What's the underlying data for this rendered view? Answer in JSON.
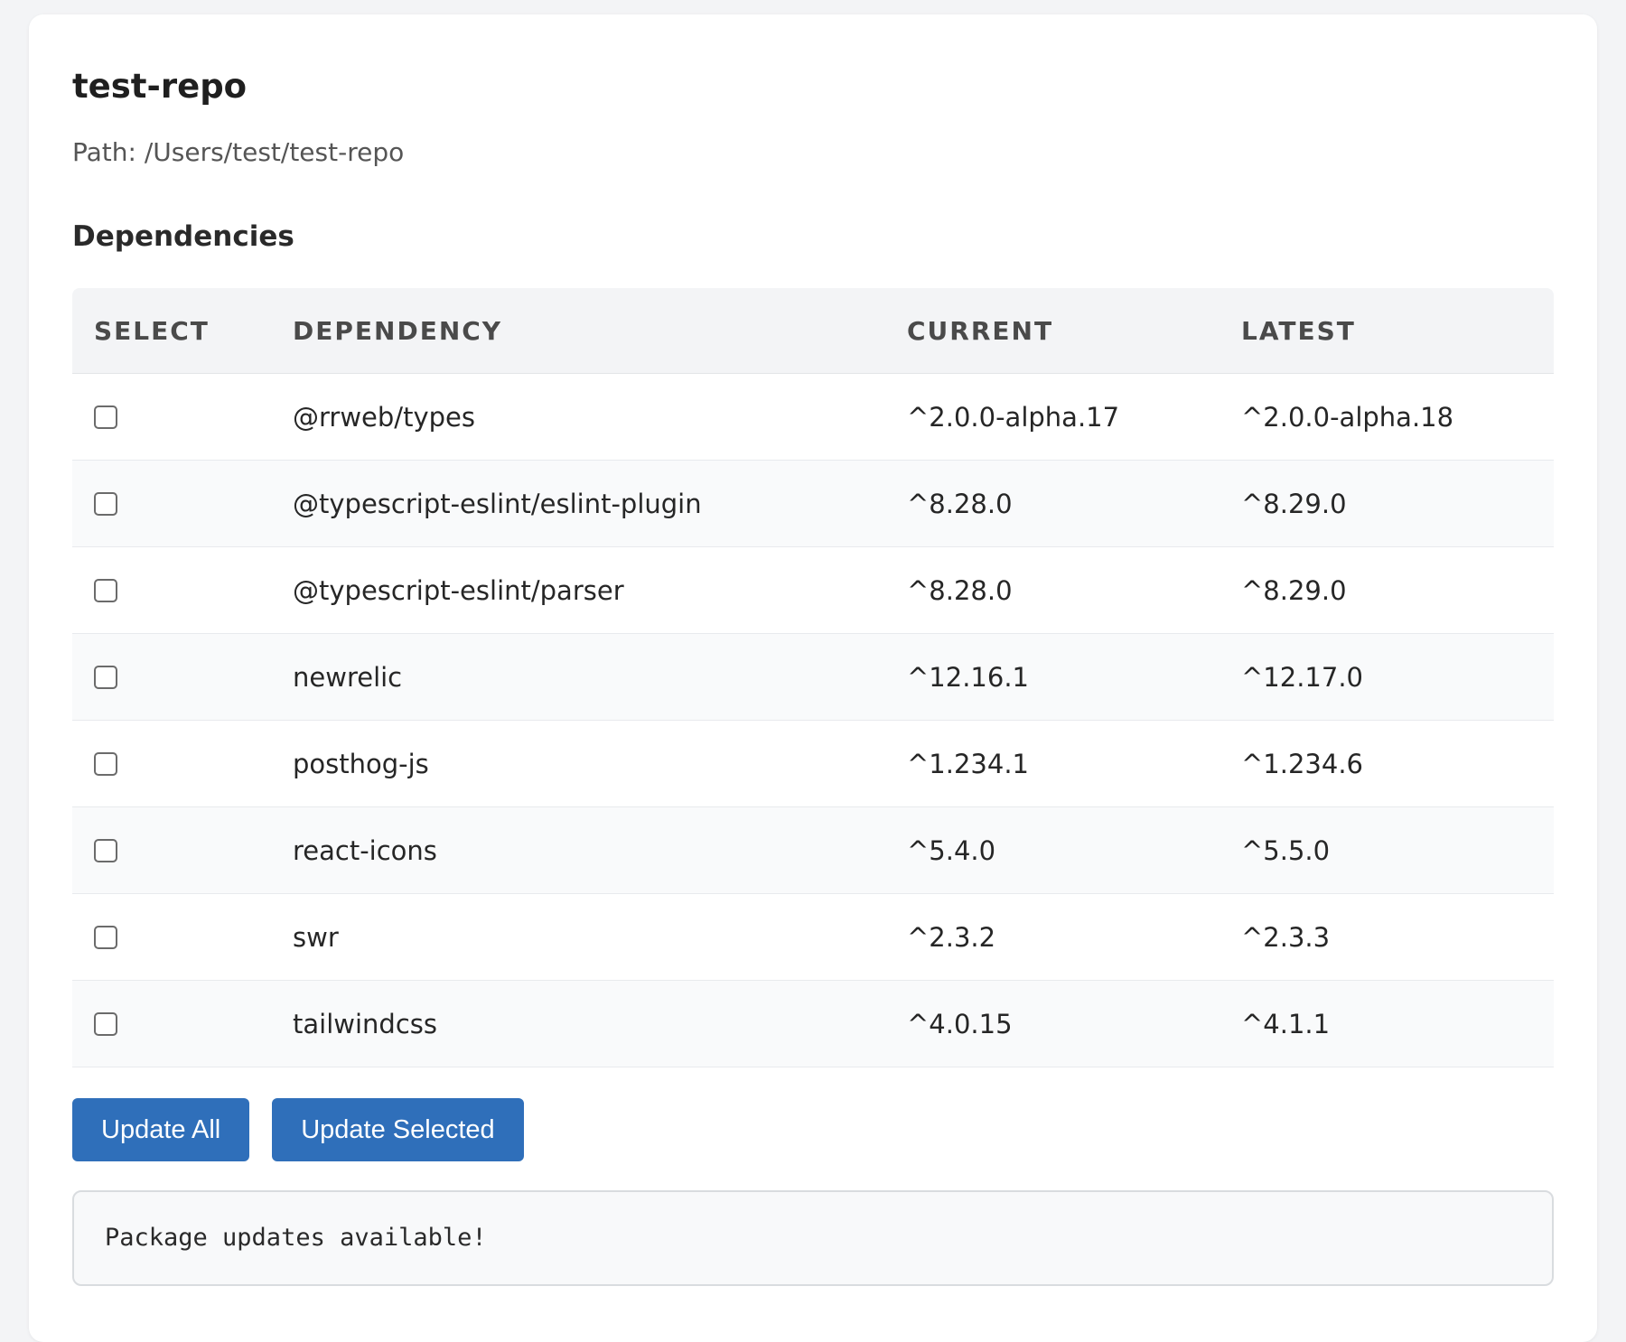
{
  "repo": {
    "name": "test-repo",
    "path": "Path: /Users/test/test-repo"
  },
  "dependencies_section": {
    "title": "Dependencies"
  },
  "table": {
    "headers": [
      "SELECT",
      "DEPENDENCY",
      "CURRENT",
      "LATEST"
    ],
    "rows": [
      {
        "name": "@rrweb/types",
        "current": "^2.0.0-alpha.17",
        "latest": "^2.0.0-alpha.18",
        "selected": false
      },
      {
        "name": "@typescript-eslint/eslint-plugin",
        "current": "^8.28.0",
        "latest": "^8.29.0",
        "selected": false
      },
      {
        "name": "@typescript-eslint/parser",
        "current": "^8.28.0",
        "latest": "^8.29.0",
        "selected": false
      },
      {
        "name": "newrelic",
        "current": "^12.16.1",
        "latest": "^12.17.0",
        "selected": false
      },
      {
        "name": "posthog-js",
        "current": "^1.234.1",
        "latest": "^1.234.6",
        "selected": false
      },
      {
        "name": "react-icons",
        "current": "^5.4.0",
        "latest": "^5.5.0",
        "selected": false
      },
      {
        "name": "swr",
        "current": "^2.3.2",
        "latest": "^2.3.3",
        "selected": false
      },
      {
        "name": "tailwindcss",
        "current": "^4.0.15",
        "latest": "^4.1.1",
        "selected": false
      }
    ]
  },
  "actions": {
    "update_all_label": "Update All",
    "update_selected_label": "Update Selected"
  },
  "output": {
    "message": "Package updates available!"
  },
  "colors": {
    "button_bg": "#2f6fba",
    "header_bg": "#f3f4f6",
    "page_bg": "#f3f4f6"
  }
}
